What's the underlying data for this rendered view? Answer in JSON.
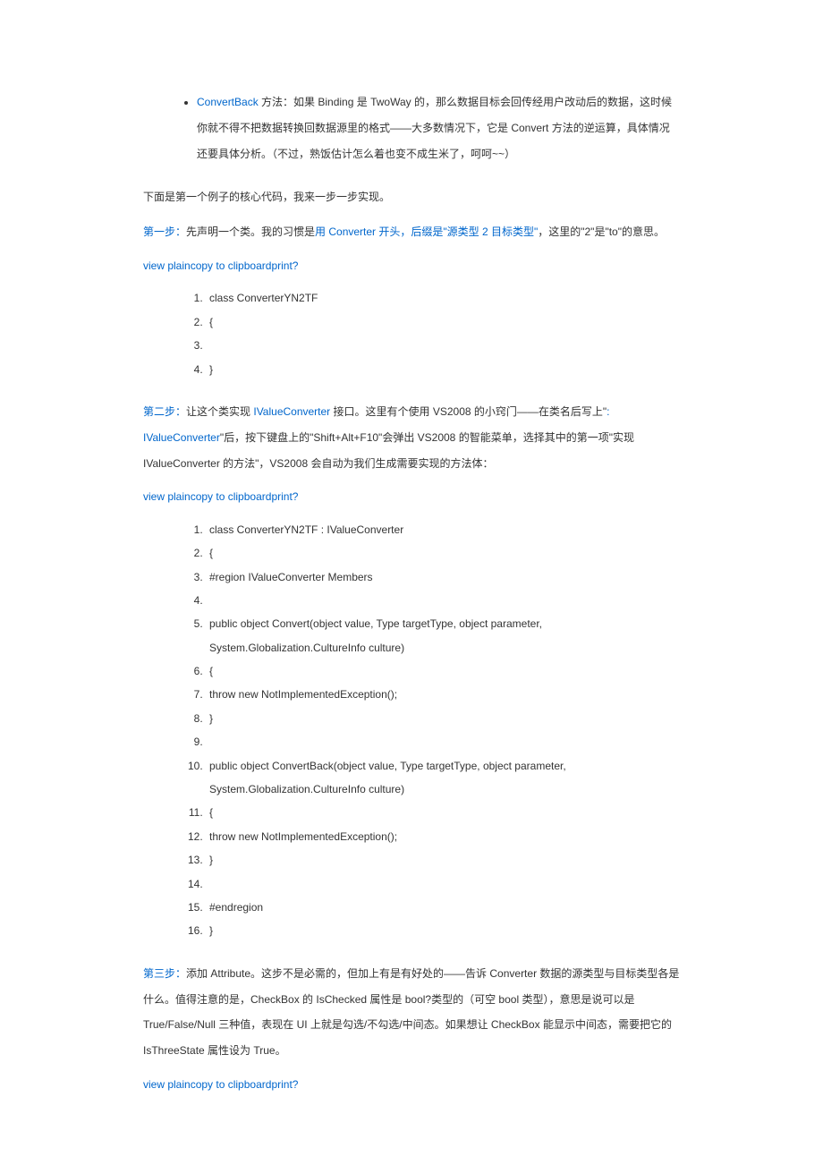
{
  "bullet": {
    "convertback_label": "ConvertBack",
    "convertback_text": " 方法：如果 Binding 是 TwoWay 的，那么数据目标会回传经用户改动后的数据，这时候你就不得不把数据转换回数据源里的格式——大多数情况下，它是 Convert 方法的逆运算，具体情况还要具体分析。（不过，熟饭估计怎么着也变不成生米了，呵呵~~）"
  },
  "intro": "下面是第一个例子的核心代码，我来一步一步实现。",
  "step1": {
    "label": "第一步：",
    "text_before": "先声明一个类。我的习惯是",
    "link1": "用 Converter 开头，后缀是\"源类型 2 目标类型\"",
    "text_after": "，这里的\"2\"是\"to\"的意思。"
  },
  "viewlinks": {
    "view_plain": "view plain",
    "copy": "copy to clipboard",
    "print": "print",
    "q": "?"
  },
  "code1": [
    "class ConverterYN2TF",
    "{",
    "",
    "}"
  ],
  "step2": {
    "label": "第二步：",
    "text1": "让这个类实现 ",
    "link1": "IValueConverter",
    "text2": " 接口。这里有个使用 VS2008 的小窍门——在类名后写上\"",
    "link2": ": IValueConverter",
    "text3": "\"后，按下键盘上的\"Shift+Alt+F10\"会弹出 VS2008 的智能菜单，选择其中的第一项\"实现 IValueConverter 的方法\"，VS2008 会自动为我们生成需要实现的方法体："
  },
  "code2": [
    "class ConverterYN2TF : IValueConverter",
    "{",
    "    #region IValueConverter Members",
    "",
    "    public object Convert(object value, Type targetType, object parameter, System.Globalization.CultureInfo culture)",
    "    {",
    "        throw new NotImplementedException();",
    "    }",
    "",
    "    public object ConvertBack(object value, Type targetType, object parameter, System.Globalization.CultureInfo culture)",
    "    {",
    "        throw new NotImplementedException();",
    "    }",
    "",
    "    #endregion",
    "}"
  ],
  "step3": {
    "label": "第三步：",
    "text": "添加 Attribute。这步不是必需的，但加上有是有好处的——告诉 Converter 数据的源类型与目标类型各是什么。值得注意的是，CheckBox 的 IsChecked 属性是 bool?类型的（可空 bool 类型），意思是说可以是 True/False/Null 三种值，表现在 UI 上就是勾选/不勾选/中间态。如果想让 CheckBox 能显示中间态，需要把它的 IsThreeState 属性设为 True。"
  }
}
